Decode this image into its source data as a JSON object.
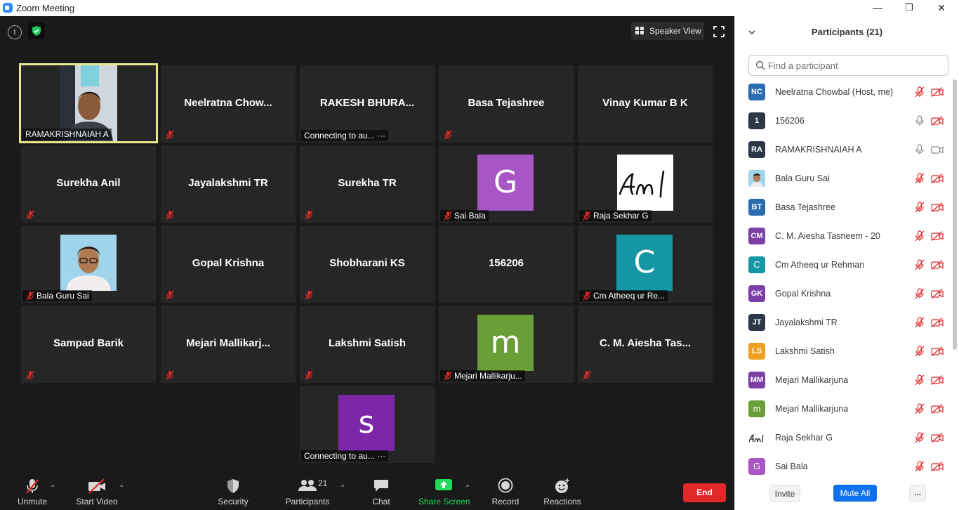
{
  "window": {
    "title": "Zoom Meeting",
    "minimize": "—",
    "restore": "❐",
    "close": "✕"
  },
  "view": {
    "speaker_view_label": "Speaker View"
  },
  "tiles": [
    {
      "name": "RAMAKRISHNAIAH A",
      "style": "video",
      "label": "RAMAKRISHNAIAH A",
      "active": true
    },
    {
      "name": "Neelratna  Chow...",
      "style": "name",
      "muted": true
    },
    {
      "name": "RAKESH  BHURA...",
      "style": "name",
      "label": "Connecting to au...",
      "connecting": true
    },
    {
      "name": "Basa Tejashree",
      "style": "name",
      "muted": true
    },
    {
      "name": "Vinay Kumar B K",
      "style": "name"
    },
    {
      "name": "Surekha Anil",
      "style": "name",
      "muted": true
    },
    {
      "name": "Jayalakshmi TR",
      "style": "name",
      "muted": true
    },
    {
      "name": "Surekha TR",
      "style": "name",
      "muted": true
    },
    {
      "name": "Sai Bala",
      "style": "avatar",
      "letter": "G",
      "color": "#a855c6",
      "label": "Sai Bala",
      "muted": true
    },
    {
      "name": "Raja Sekhar G",
      "style": "signature",
      "letter": "Am l",
      "label": "Raja Sekhar G",
      "muted": true
    },
    {
      "name": "Bala Guru Sai",
      "style": "photo",
      "label": "Bala Guru Sai",
      "muted": true
    },
    {
      "name": "Gopal Krishna",
      "style": "name",
      "muted": true
    },
    {
      "name": "Shobharani KS",
      "style": "name",
      "muted": true
    },
    {
      "name": "156206",
      "style": "name"
    },
    {
      "name": "Cm Atheeq ur Re...",
      "style": "avatar",
      "letter": "C",
      "color": "#1697a6",
      "label": "Cm Atheeq ur Re...",
      "muted": true
    },
    {
      "name": "Sampad Barik",
      "style": "name",
      "muted": true
    },
    {
      "name": "Mejari  Mallikarj...",
      "style": "name",
      "muted": true
    },
    {
      "name": "Lakshmi Satish",
      "style": "name",
      "muted": true
    },
    {
      "name": "Mejari Mallikarju...",
      "style": "avatar",
      "letter": "m",
      "color": "#6a9e36",
      "label": "Mejari Mallikarju...",
      "muted": true
    },
    {
      "name": "C. M. Aiesha Tas...",
      "style": "name",
      "muted": true
    },
    {
      "name": "s",
      "style": "avatar",
      "letter": "s",
      "color": "#7b27a8",
      "label": "Connecting to au...",
      "connecting": true
    }
  ],
  "toolbar": {
    "unmute": "Unmute",
    "start_video": "Start Video",
    "security": "Security",
    "participants": "Participants",
    "participants_count": "21",
    "chat": "Chat",
    "share_screen": "Share Screen",
    "record": "Record",
    "reactions": "Reactions",
    "end": "End",
    "caret": "^"
  },
  "panel": {
    "title": "Participants (21)",
    "search_placeholder": "Find a participant",
    "invite": "Invite",
    "mute_all": "Mute All",
    "more": "..."
  },
  "participants": [
    {
      "initials": "NC",
      "name": "Neelratna Chowbal (Host, me)",
      "color": "#2b6cb0",
      "mic": "muted",
      "cam": "off"
    },
    {
      "initials": "1",
      "name": "156206",
      "color": "#2d3748",
      "mic": "on",
      "cam": "off"
    },
    {
      "initials": "RA",
      "name": "RAMAKRISHNAIAH A",
      "color": "#2d3748",
      "mic": "on",
      "cam": "on"
    },
    {
      "initials": "",
      "name": "Bala Guru Sai",
      "color": "photo",
      "mic": "muted",
      "cam": "off"
    },
    {
      "initials": "BT",
      "name": "Basa Tejashree",
      "color": "#2b6cb0",
      "mic": "muted",
      "cam": "off"
    },
    {
      "initials": "CM",
      "name": "C. M. Aiesha Tasneem - 20",
      "color": "#7b3fa6",
      "mic": "muted",
      "cam": "off"
    },
    {
      "initials": "C",
      "name": "Cm Atheeq ur Rehman",
      "color": "#1697a6",
      "mic": "muted",
      "cam": "off"
    },
    {
      "initials": "GK",
      "name": "Gopal Krishna",
      "color": "#7b3fa6",
      "mic": "muted",
      "cam": "off"
    },
    {
      "initials": "JT",
      "name": "Jayalakshmi TR",
      "color": "#2d3748",
      "mic": "muted",
      "cam": "off"
    },
    {
      "initials": "LS",
      "name": "Lakshmi Satish",
      "color": "#f0a020",
      "mic": "muted",
      "cam": "off"
    },
    {
      "initials": "MM",
      "name": "Mejari Mallikarjuna",
      "color": "#7b3fa6",
      "mic": "muted",
      "cam": "off"
    },
    {
      "initials": "m",
      "name": "Mejari Mallikarjuna",
      "color": "#6a9e36",
      "mic": "muted",
      "cam": "off"
    },
    {
      "initials": "Am",
      "name": "Raja Sekhar G",
      "color": "signature",
      "mic": "muted",
      "cam": "off"
    },
    {
      "initials": "G",
      "name": "Sai Bala",
      "color": "#a855c6",
      "mic": "muted",
      "cam": "off"
    }
  ]
}
